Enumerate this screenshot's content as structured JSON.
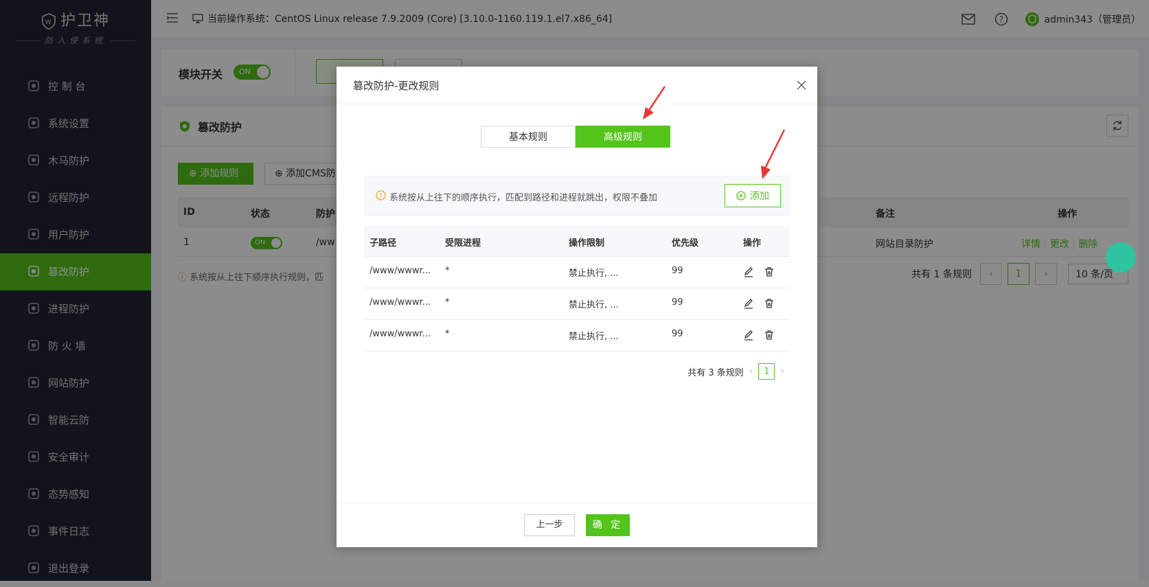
{
  "brand": {
    "title": "护卫神",
    "subtitle": "防入侵系统"
  },
  "sidebar": {
    "items": [
      {
        "label": "控 制 台",
        "icon": "dashboard-icon"
      },
      {
        "label": "系统设置",
        "icon": "gear-icon"
      },
      {
        "label": "木马防护",
        "icon": "shield-icon"
      },
      {
        "label": "远程防护",
        "icon": "monitor-icon"
      },
      {
        "label": "用户防护",
        "icon": "users-icon"
      },
      {
        "label": "篡改防护",
        "icon": "tamper-icon",
        "active": true
      },
      {
        "label": "进程防护",
        "icon": "process-icon"
      },
      {
        "label": "防 火 墙",
        "icon": "firewall-icon"
      },
      {
        "label": "网站防护",
        "icon": "globe-icon"
      },
      {
        "label": "智能云防",
        "icon": "cloud-icon"
      },
      {
        "label": "安全审计",
        "icon": "audit-icon"
      },
      {
        "label": "态势感知",
        "icon": "radar-icon"
      },
      {
        "label": "事件日志",
        "icon": "log-icon"
      },
      {
        "label": "退出登录",
        "icon": "logout-icon"
      }
    ]
  },
  "topbar": {
    "os_label": "当前操作系统：",
    "os_value": "CentOS Linux release 7.9.2009 (Core) [3.10.0-1160.119.1.el7.x86_64]",
    "user": "admin343（管理员）"
  },
  "module": {
    "label": "模块开关",
    "toggle": "ON"
  },
  "panel": {
    "title": "篡改防护",
    "add_rule": "添加规则",
    "add_cms": "添加CMS防",
    "headers": {
      "id": "ID",
      "status": "状态",
      "path": "防护",
      "note": "备注",
      "ops": "操作"
    },
    "row": {
      "id": "1",
      "status": "ON",
      "path": "/ww",
      "note": "网站目录防护",
      "op_detail": "详情",
      "op_edit": "更改",
      "op_delete": "删除"
    },
    "note": "系统按从上往下顺序执行规则，匹",
    "pagination": {
      "total": "共有 1 条规则",
      "page": "1",
      "page_size": "10 条/页"
    }
  },
  "modal": {
    "title": "篡改防护-更改规则",
    "tabs": {
      "basic": "基本规则",
      "advanced": "高级规则"
    },
    "tip": "系统按从上往下的顺序执行，匹配到路径和进程就跳出，权限不叠加",
    "add": "添加",
    "headers": {
      "path": "子路径",
      "process": "受限进程",
      "limit": "操作限制",
      "priority": "优先级",
      "ops": "操作"
    },
    "rows": [
      {
        "path": "/www/wwwr...",
        "process": "*",
        "limit": "禁止执行, ...",
        "priority": "99"
      },
      {
        "path": "/www/wwwr...",
        "process": "*",
        "limit": "禁止执行, ...",
        "priority": "99"
      },
      {
        "path": "/www/wwwr...",
        "process": "*",
        "limit": "禁止执行, ...",
        "priority": "99"
      }
    ],
    "pagination": {
      "total": "共有 3 条规则",
      "page": "1"
    },
    "prev": "上一步",
    "confirm": "确 定"
  },
  "colors": {
    "accent": "#52c41a",
    "sidebar": "#1f2532",
    "annotation": "#e53935"
  }
}
